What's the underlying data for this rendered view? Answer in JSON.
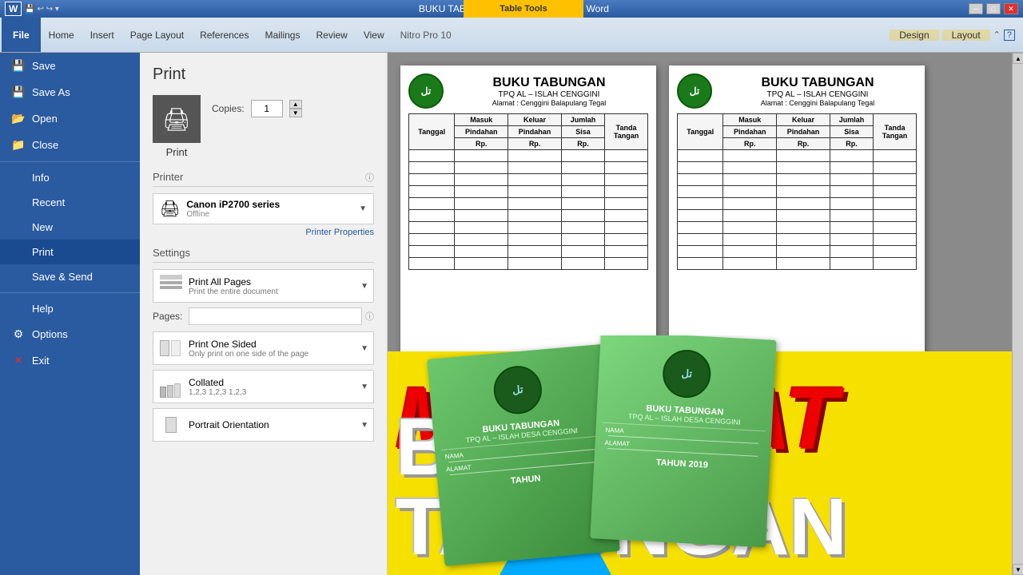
{
  "titlebar": {
    "title": "BUKU TABUNGAN DALAM - Microsoft Word",
    "table_tools": "Table Tools",
    "min_label": "─",
    "max_label": "□",
    "close_label": "✕"
  },
  "ribbon": {
    "file_tab": "File",
    "tabs": [
      "Home",
      "Insert",
      "Page Layout",
      "References",
      "Mailings",
      "Review",
      "View",
      "Nitro Pro 10"
    ],
    "tool_tabs": [
      "Design",
      "Layout"
    ],
    "help_icon": "?",
    "arrow_icon": "⌃"
  },
  "sidebar": {
    "items": [
      {
        "id": "save",
        "label": "Save",
        "icon": "💾"
      },
      {
        "id": "save-as",
        "label": "Save As",
        "icon": "💾"
      },
      {
        "id": "open",
        "label": "Open",
        "icon": "📁"
      },
      {
        "id": "close",
        "label": "Close",
        "icon": "📁"
      },
      {
        "id": "info",
        "label": "Info",
        "icon": ""
      },
      {
        "id": "recent",
        "label": "Recent",
        "icon": ""
      },
      {
        "id": "new",
        "label": "New",
        "icon": ""
      },
      {
        "id": "print",
        "label": "Print",
        "icon": "",
        "active": true
      },
      {
        "id": "save-send",
        "label": "Save & Send",
        "icon": ""
      },
      {
        "id": "help",
        "label": "Help",
        "icon": ""
      },
      {
        "id": "options",
        "label": "Options",
        "icon": "⚙"
      },
      {
        "id": "exit",
        "label": "Exit",
        "icon": "✕"
      }
    ]
  },
  "print_panel": {
    "title": "Print",
    "print_button": "Print",
    "copies_label": "Copies:",
    "copies_value": "1",
    "printer_section": "Printer",
    "printer_name": "Canon iP2700 series",
    "printer_status": "Offline",
    "printer_properties": "Printer Properties",
    "settings_section": "Settings",
    "info_icon": "ⓘ",
    "print_option": {
      "main": "Print All Pages",
      "sub": "Print the entire document"
    },
    "pages_label": "Pages:",
    "pages_placeholder": "",
    "sides_option": {
      "main": "Print One Sided",
      "sub": "Only print on one side of the page"
    },
    "collate_option": {
      "main": "Collated",
      "sub": "1,2,3  1,2,3  1,2,3"
    },
    "orientation_option": {
      "main": "Portrait Orientation",
      "sub": ""
    }
  },
  "document": {
    "pages": [
      {
        "title": "BUKU TABUNGAN",
        "org1": "TPQ AL – ISLAH CENGGINI",
        "org2": "Alamat : Cenggini Balapulang Tegal",
        "logo_text": "تلاوتي",
        "columns": [
          "Tanggal",
          "Masuk\nPindahan\nRp.",
          "Keluar\nPindahan\nRp.",
          "Jumlah\nSisa\nRp.",
          "Tanda\nTangan"
        ]
      },
      {
        "title": "BUKU TABUNGAN",
        "org1": "TPQ AL – ISLAH CENGGINI",
        "org2": "Alamat : Cenggini Balapulang Tegal",
        "logo_text": "تلاوتي",
        "columns": [
          "Tanggal",
          "Masuk\nPindahan\nRp.",
          "Keluar\nPindahan\nRp.",
          "Jumlah\nSisa\nRp.",
          "Tanda\nTangan"
        ]
      }
    ]
  },
  "overlay": {
    "membuat": "MEMBUAT",
    "buku_tabungan": "BUKU TABUNGAN"
  },
  "booklets": [
    {
      "title": "BUKU TABUNGAN",
      "org": "TPQ AL – ISLAH DESA CENGGINI",
      "logo_text": "تلاوتي",
      "nama_label": "NAMA",
      "alamat_label": "ALAMAT",
      "year": "TAHUN"
    },
    {
      "title": "BUKU TABUNGAN",
      "org": "TPQ AL – ISLAH DESA CENGGINI",
      "logo_text": "تلاوتي",
      "nama_label": "NAMA",
      "alamat_label": "ALAMAT",
      "year": "TAHUN 2019"
    }
  ]
}
